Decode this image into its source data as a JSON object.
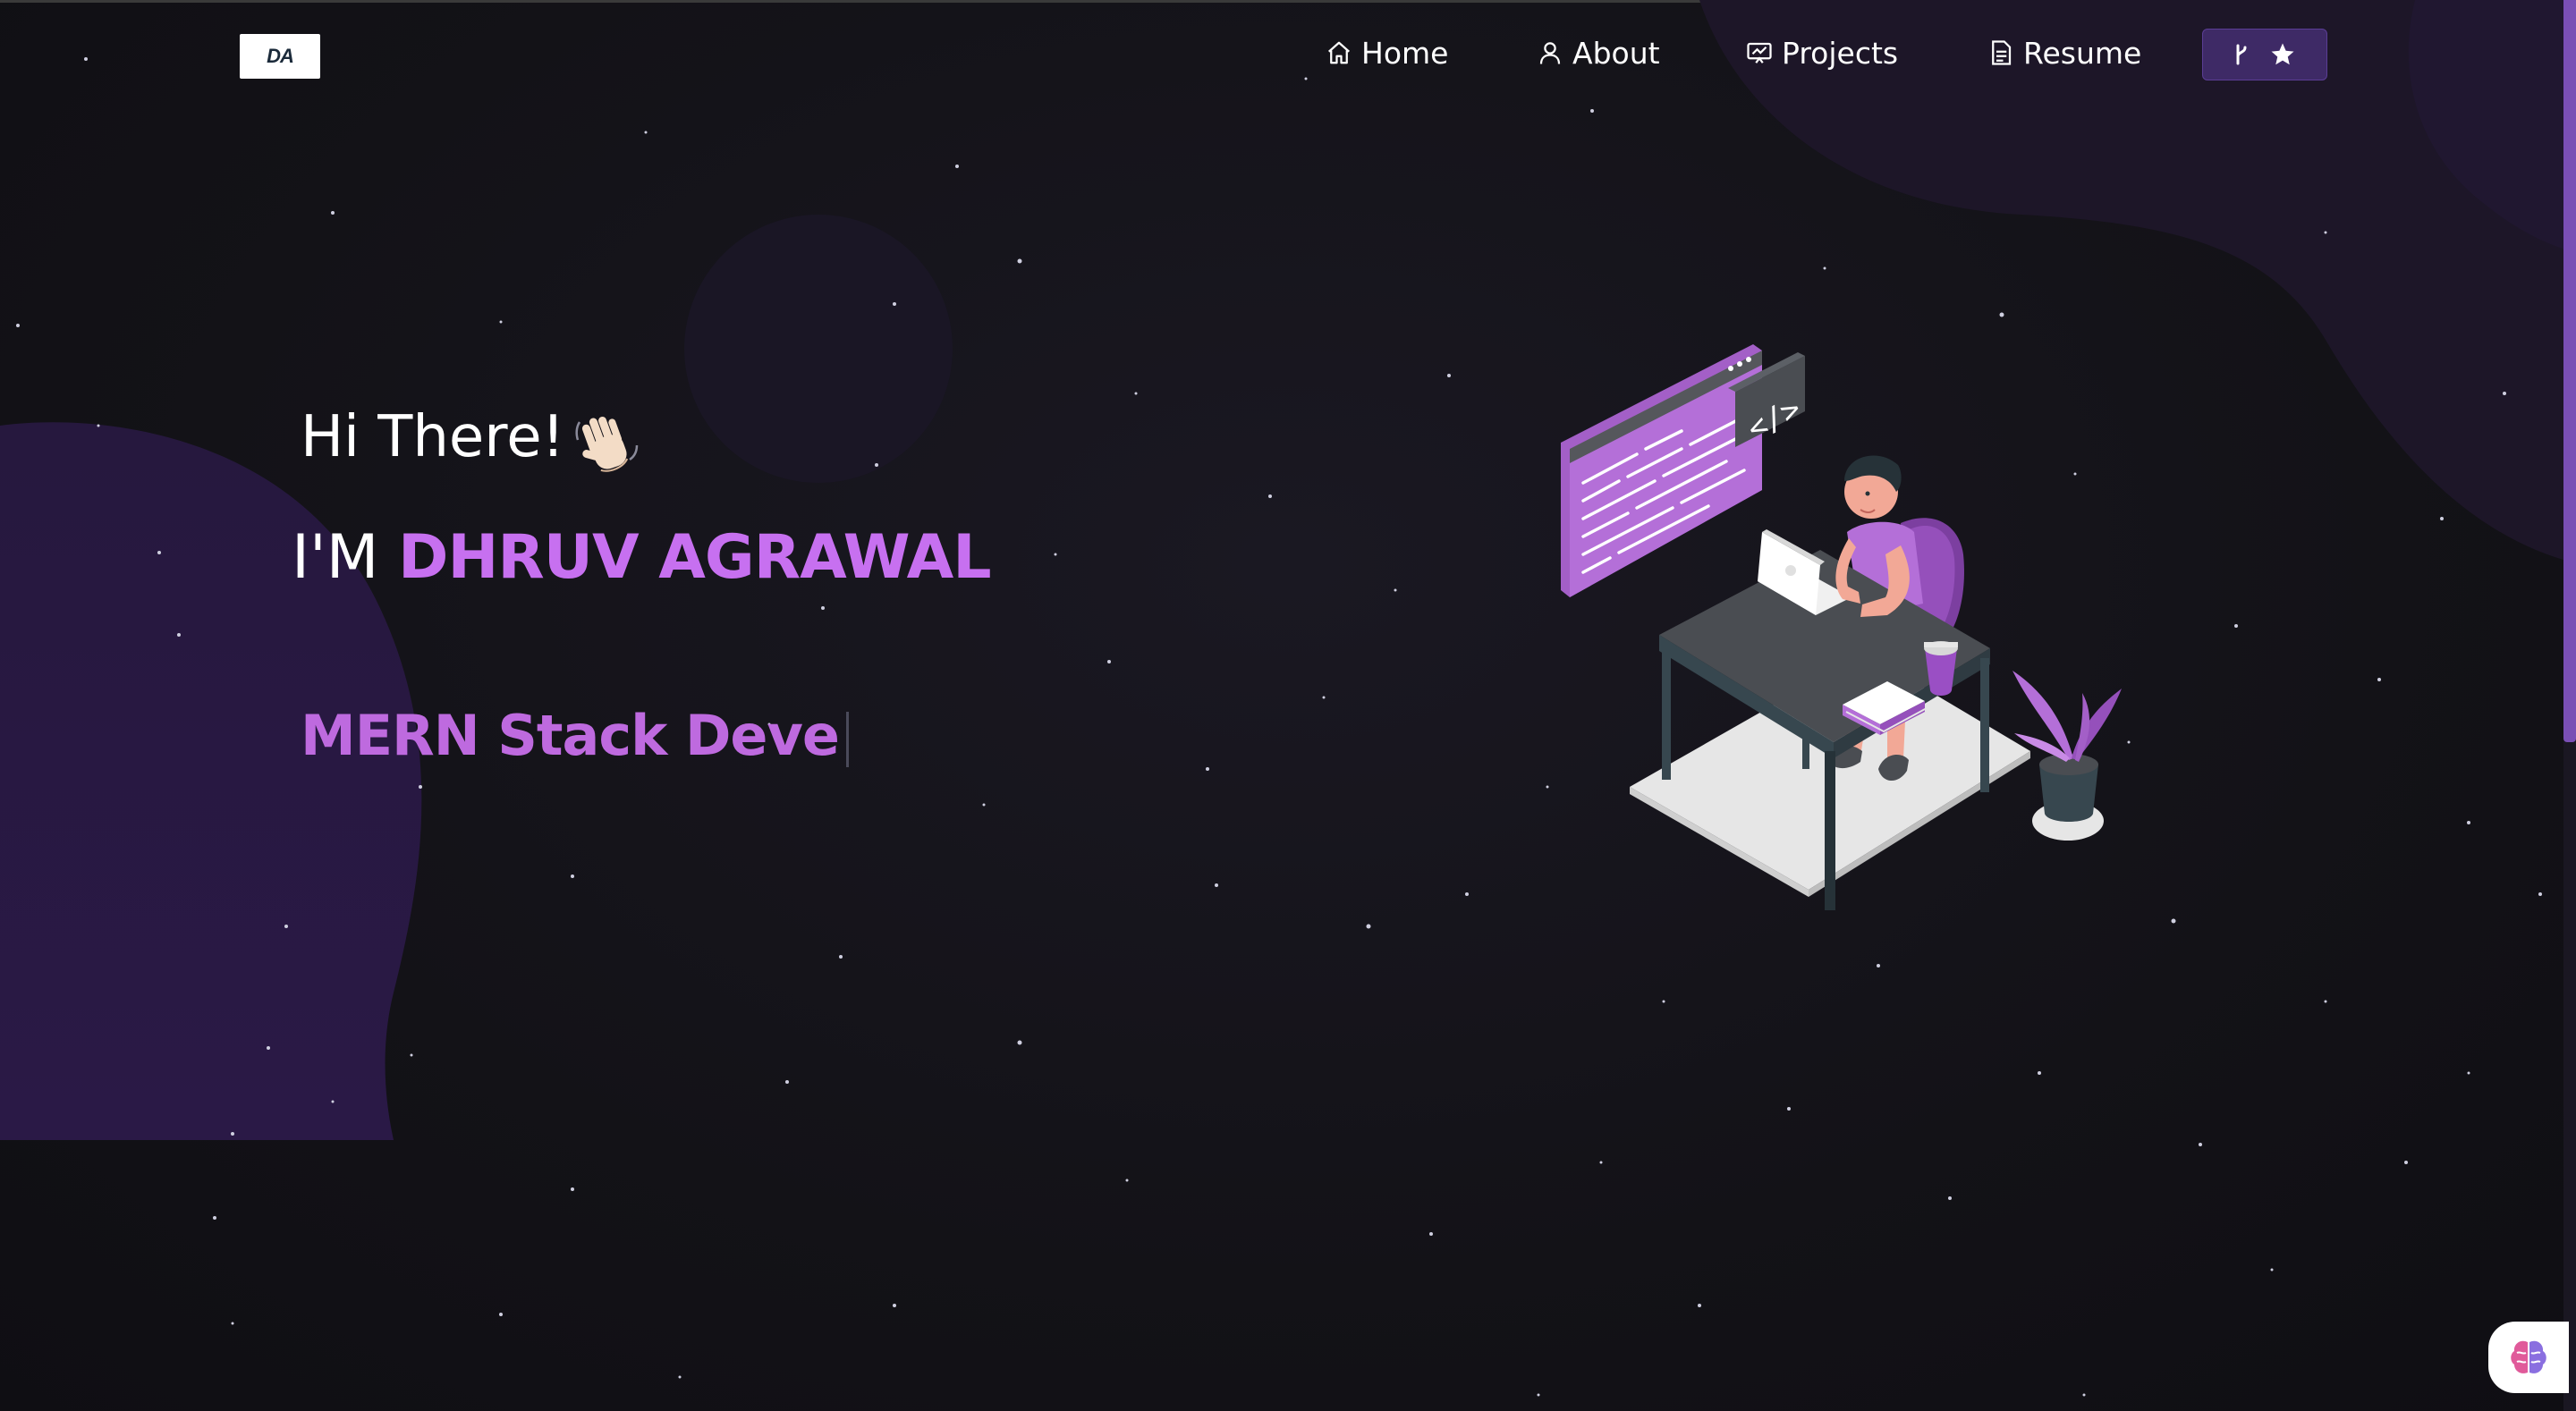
{
  "brand": {
    "logo_text": "DA"
  },
  "nav": {
    "items": [
      {
        "label": "Home",
        "icon": "home-icon"
      },
      {
        "label": "About",
        "icon": "user-icon"
      },
      {
        "label": "Projects",
        "icon": "projects-icon"
      },
      {
        "label": "Resume",
        "icon": "document-icon"
      }
    ],
    "github_button": {
      "icons": [
        "fork-icon",
        "star-icon"
      ]
    }
  },
  "hero": {
    "greeting": "Hi There!",
    "greeting_emoji": "waving-hand-icon",
    "intro_prefix": "I'M",
    "name": "DHRUV AGRAWAL",
    "typed_text": "MERN Stack Deve"
  },
  "colors": {
    "background": "#131217",
    "accent": "#c770f0",
    "typed": "#be6adf",
    "github_button": "#3e2a66"
  },
  "widget": {
    "icon": "brain-icon"
  }
}
